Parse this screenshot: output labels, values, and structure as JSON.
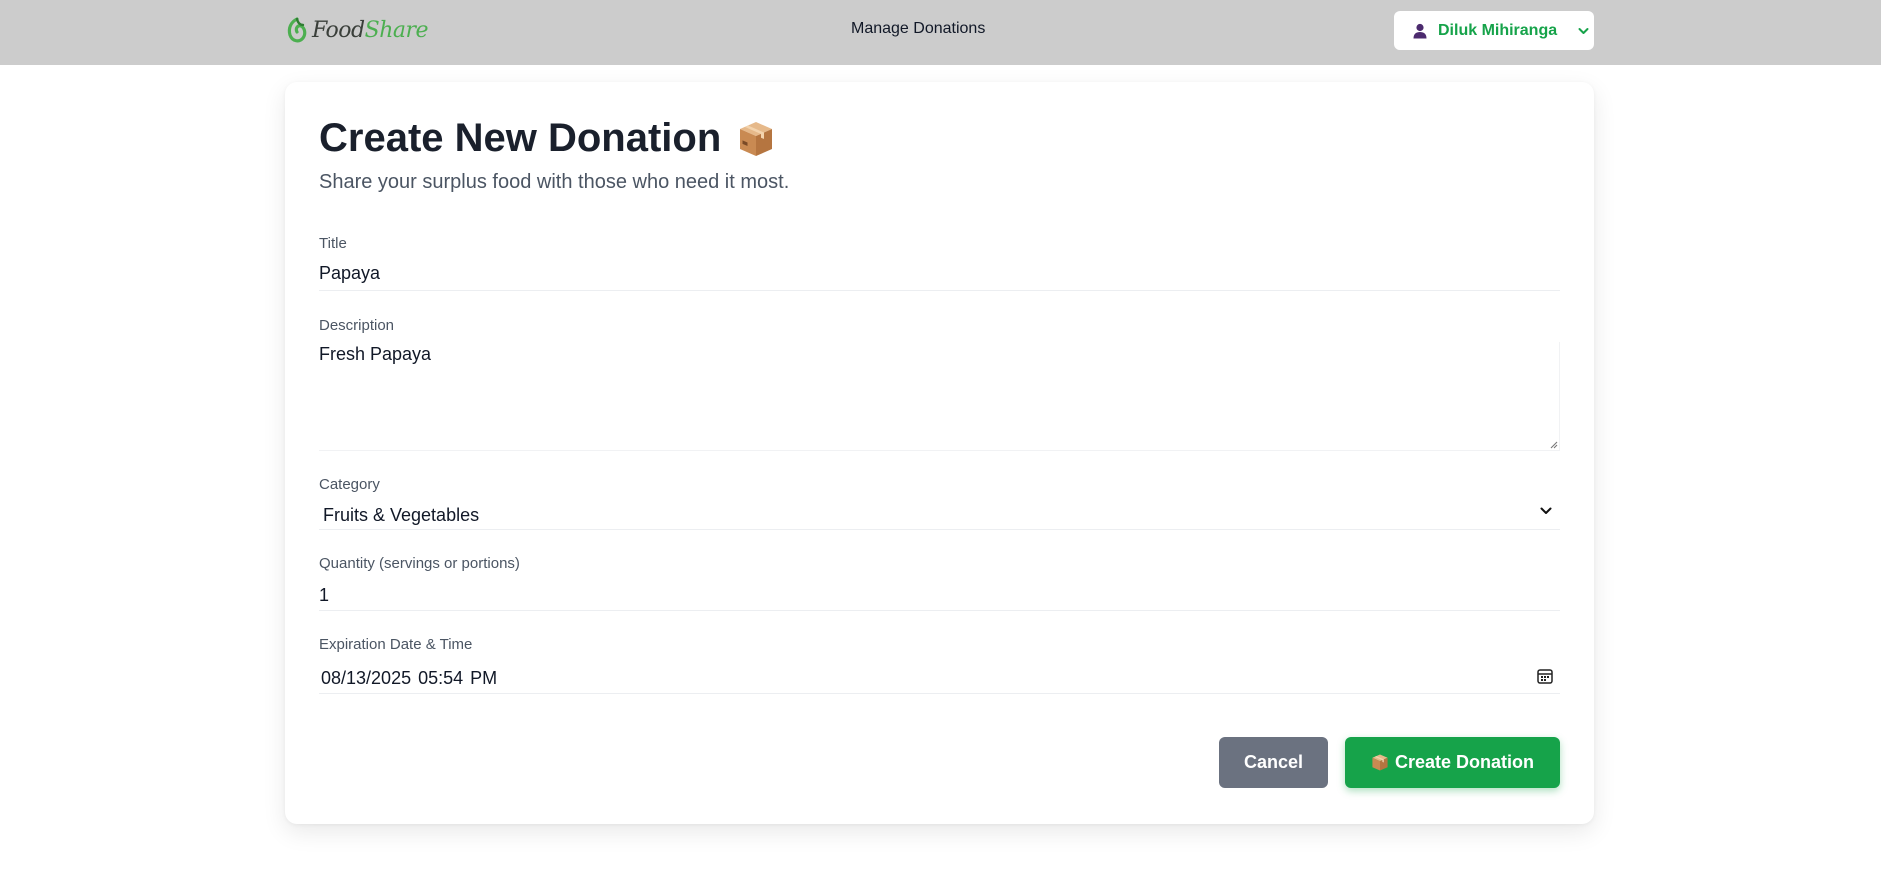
{
  "header": {
    "logo_part1": "Food",
    "logo_part2": "Share",
    "nav_link": "Manage Donations",
    "user_name": "Diluk Mihiranga",
    "icons": {
      "user": "user-icon",
      "dropdown": "chevron-down-icon"
    },
    "colors": {
      "bar": "#cccccc",
      "accent": "#16a34a"
    }
  },
  "form": {
    "title": "Create New Donation",
    "title_icon": "package-icon",
    "subtitle": "Share your surplus food with those who need it most.",
    "fields": {
      "title": {
        "label": "Title",
        "value": "Papaya"
      },
      "description": {
        "label": "Description",
        "value": "Fresh Papaya"
      },
      "category": {
        "label": "Category",
        "value": "Fruits & Vegetables"
      },
      "quantity": {
        "label": "Quantity (servings or portions)",
        "value": "1"
      },
      "expiration": {
        "label": "Expiration Date & Time",
        "value": "08/13/2025 05:54 PM"
      }
    },
    "buttons": {
      "cancel": "Cancel",
      "create": "Create Donation"
    },
    "colors": {
      "cancel": "#6b7280",
      "create": "#16a34a"
    }
  }
}
